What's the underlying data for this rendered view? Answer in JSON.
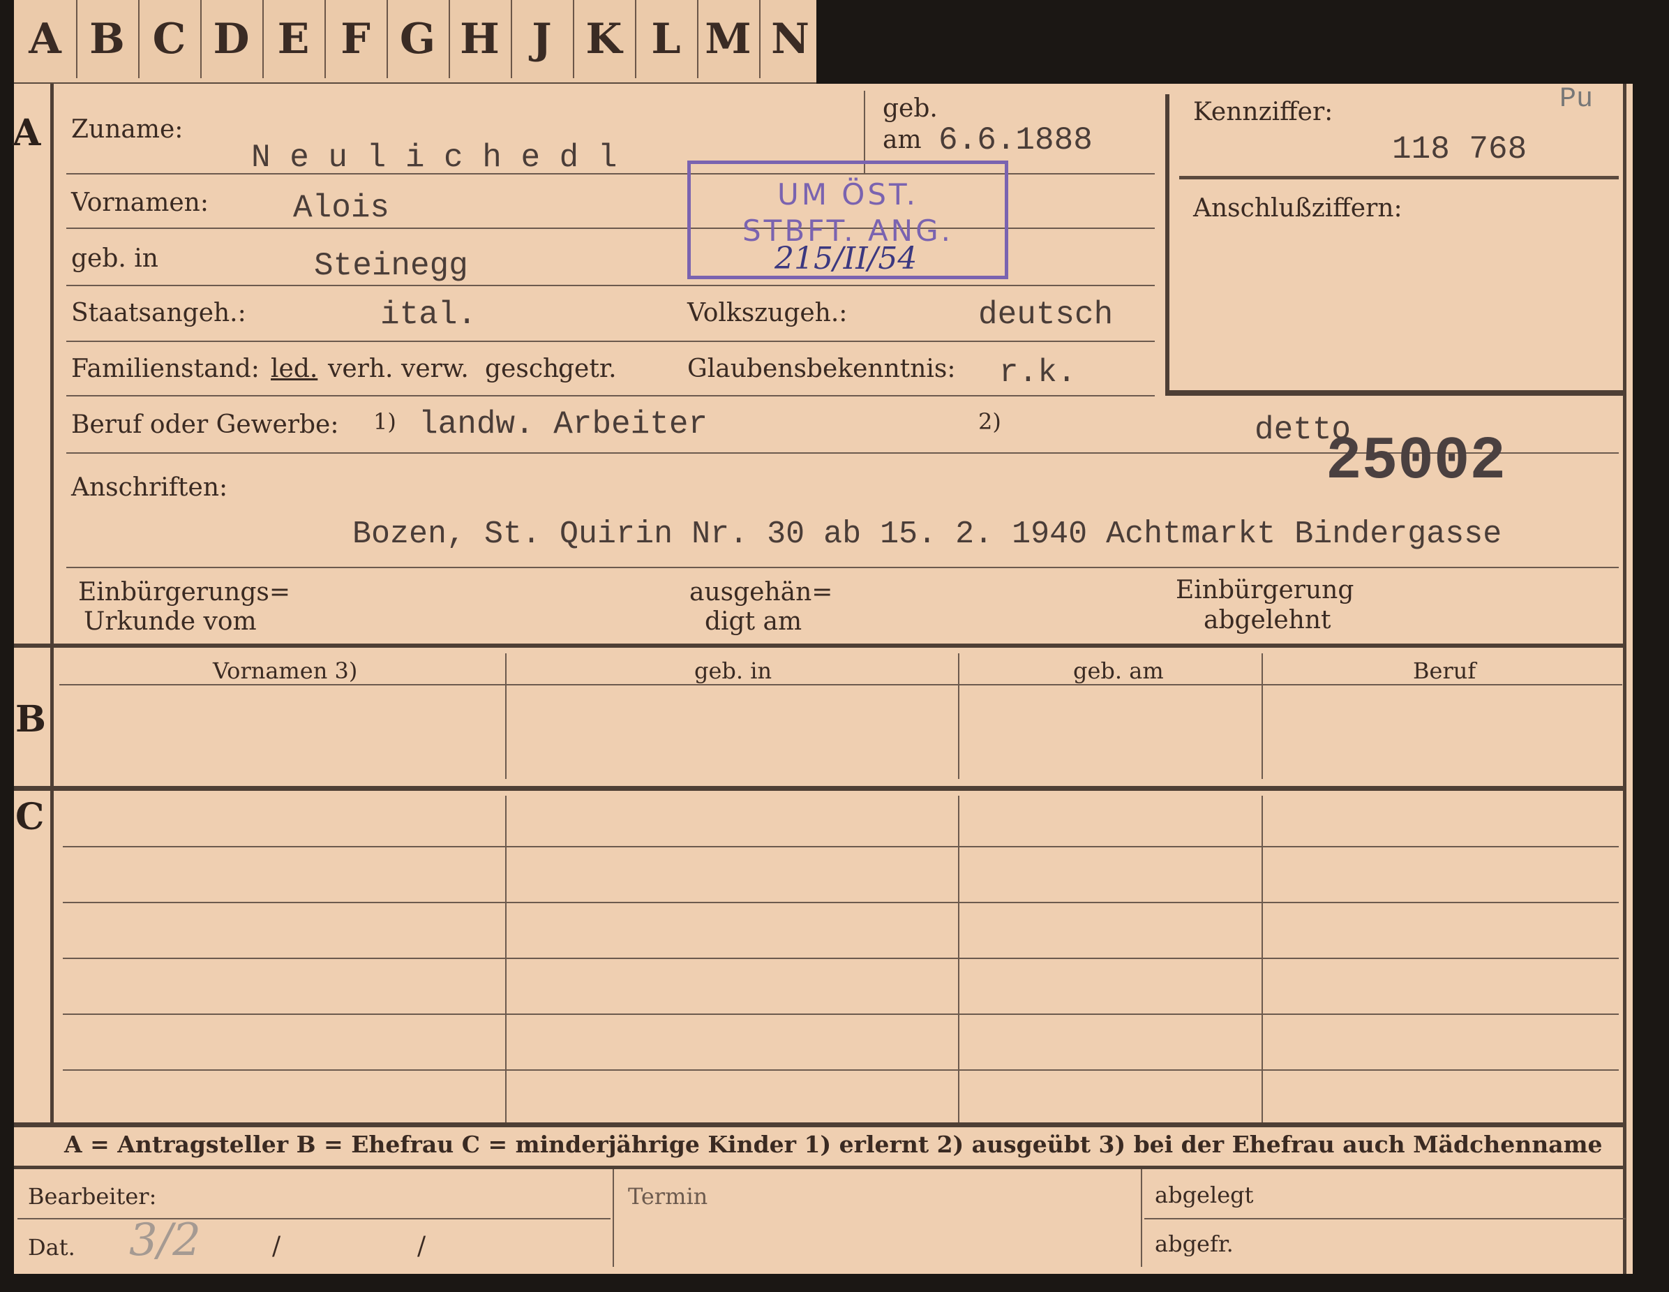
{
  "tabs": [
    "A",
    "B",
    "C",
    "D",
    "E",
    "F",
    "G",
    "H",
    "J",
    "K",
    "L",
    "M",
    "N"
  ],
  "section_letters": {
    "a": "A",
    "b": "B",
    "c": "C"
  },
  "labels": {
    "zuname": "Zuname:",
    "geb": "geb.",
    "am": "am",
    "vornamen": "Vornamen:",
    "geb_in": "geb. in",
    "staatsangeh": "Staatsangeh.:",
    "volkszugeh": "Volkszugeh.:",
    "familienstand": "Familienstand:",
    "familienstand_options": [
      "led.",
      "verh.",
      "verw.",
      "gesch.",
      "getr."
    ],
    "glaubensbekenntnis": "Glaubensbekenntnis:",
    "beruf": "Beruf oder Gewerbe:",
    "fn1": "1)",
    "fn2": "2)",
    "anschriften": "Anschriften:",
    "einbuergerungs_1": "Einbürgerungs=",
    "einbuergerungs_2": "Urkunde vom",
    "ausgehaen_1": "ausgehän=",
    "ausgehaen_2": "digt am",
    "einb_abgelehnt_1": "Einbürgerung",
    "einb_abgelehnt_2": "abgelehnt",
    "kennziffer": "Kennziffer:",
    "anschlussziffern": "Anschlußziffern:"
  },
  "values": {
    "zuname": "N e u l i c h e d l",
    "geb_am": "6.6.1888",
    "vornamen": "Alois",
    "geb_in": "Steinegg",
    "staatsangeh": "ital.",
    "volkszugeh": "deutsch",
    "glaubensbekenntnis": "r.k.",
    "beruf_erlernt": "landw. Arbeiter",
    "beruf_ausgeuebt": "detto",
    "kennziffer": "118 768",
    "kennziffer_note": "Pu",
    "big_number": "25002",
    "anschrift": "Bozen, St. Quirin Nr. 30 ab 15. 2. 1940 Achtmarkt Bindergasse"
  },
  "stamp": {
    "line1": "UM ÖST.",
    "line2": "STBFT. ANG.",
    "handwritten": "215/II/54"
  },
  "table_b_headers": [
    "Vornamen 3)",
    "geb. in",
    "geb. am",
    "Beruf"
  ],
  "legend": "A = Antragsteller   B = Ehefrau   C = minderjährige Kinder   1) erlernt   2) ausgeübt   3) bei der Ehefrau auch Mädchenname",
  "footer": {
    "bearbeiter": "Bearbeiter:",
    "dat": "Dat.",
    "dat_value": "3/2",
    "slash1": "/",
    "slash2": "/",
    "termin": "Termin",
    "abgelegt": "abgelegt",
    "abgefr": "abgefr."
  }
}
